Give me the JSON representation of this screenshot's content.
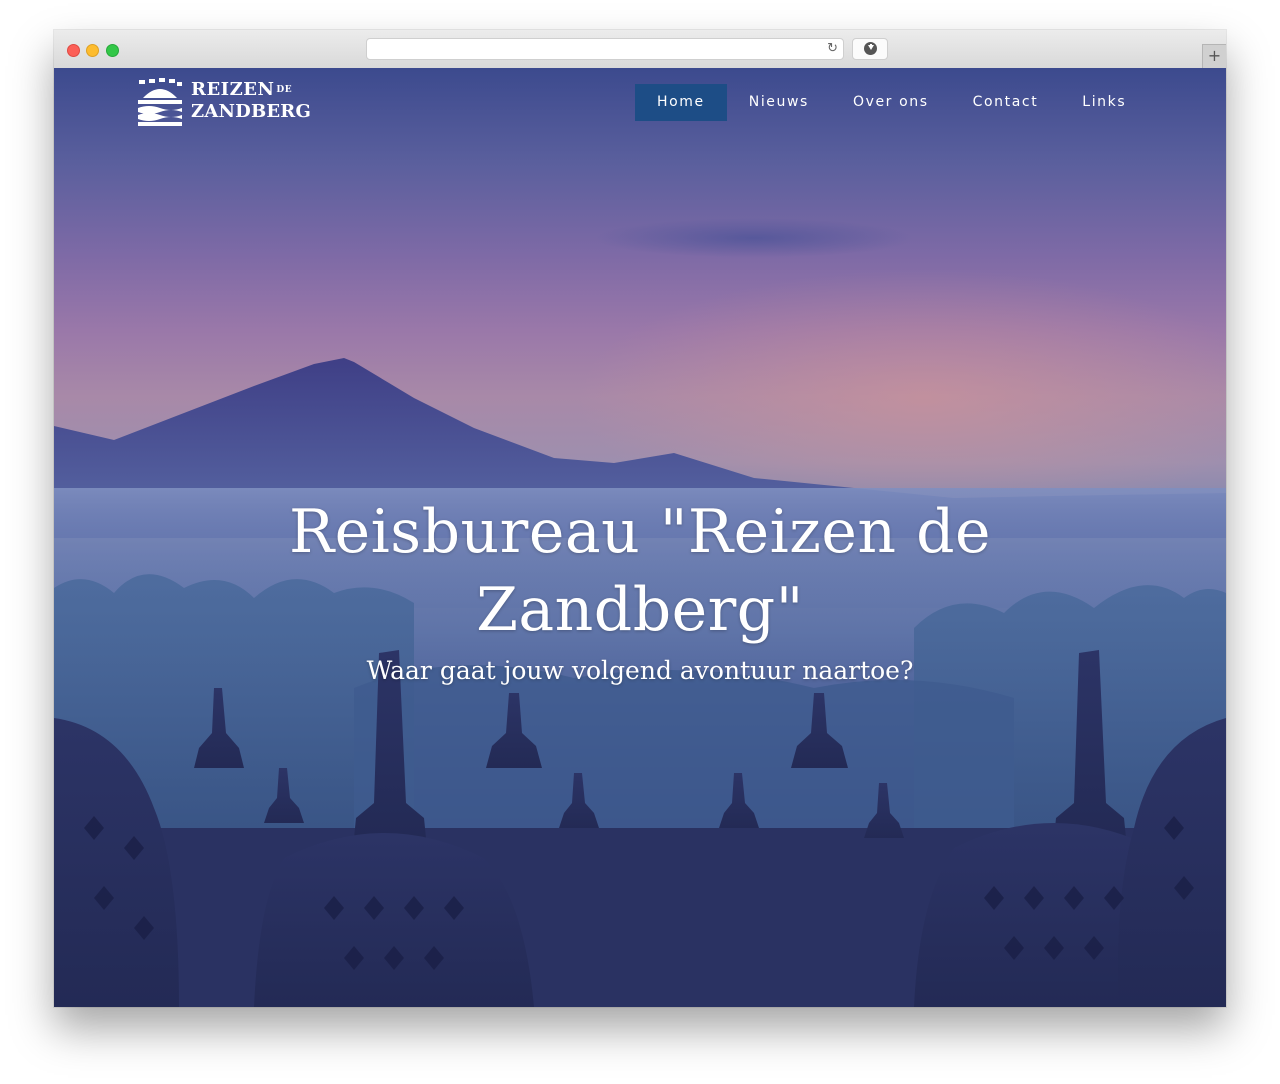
{
  "browser": {
    "reload_glyph": "↻",
    "new_tab_glyph": "+",
    "download_icon": "download-icon"
  },
  "site": {
    "logo": {
      "line1": "REIZEN",
      "line1_suffix": "DE",
      "line2": "ZANDBERG"
    },
    "nav": {
      "items": [
        {
          "label": "Home",
          "active": true
        },
        {
          "label": "Nieuws",
          "active": false
        },
        {
          "label": "Over ons",
          "active": false
        },
        {
          "label": "Contact",
          "active": false
        },
        {
          "label": "Links",
          "active": false
        }
      ],
      "active_color": "#1d4d86"
    },
    "hero": {
      "title": "Reisbureau \"Reizen de Zandberg\"",
      "subtitle": "Waar gaat jouw volgend avontuur naartoe?"
    }
  }
}
